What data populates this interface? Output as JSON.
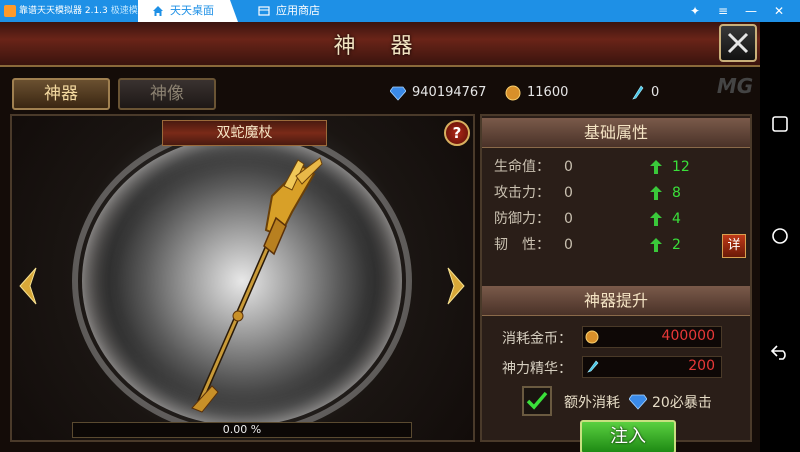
{
  "emulator": {
    "app_title": "靠谱天天模拟器 2.1.3",
    "app_mode": "极速模式",
    "tabs": [
      {
        "label": "天天桌面"
      },
      {
        "label": "应用商店"
      }
    ]
  },
  "game": {
    "title": "神 器",
    "tabs": [
      {
        "label": "神器"
      },
      {
        "label": "神像"
      }
    ],
    "currency": {
      "diamonds": "940194767",
      "gold": "11600",
      "feathers": "0"
    },
    "artifact": {
      "name": "双蛇魔杖",
      "progress_text": "0.00 %",
      "progress_fraction": 0.0
    },
    "base_stats": {
      "title": "基础属性",
      "rows": [
        {
          "label": "生命值：",
          "value": "0",
          "increase": "12"
        },
        {
          "label": "攻击力：",
          "value": "0",
          "increase": "8"
        },
        {
          "label": "防御力：",
          "value": "0",
          "increase": "4"
        },
        {
          "label": "韧　性：",
          "value": "0",
          "increase": "2"
        }
      ],
      "detail_label": "详"
    },
    "upgrade": {
      "title": "神器提升",
      "gold_cost_label": "消耗金币：",
      "gold_cost": "400000",
      "essence_label": "神力精华：",
      "essence_cost": "200",
      "extra_label": "额外消耗",
      "extra_text": "20必暴击",
      "extra_checked": true,
      "inject_label": "注入"
    }
  },
  "colors": {
    "titlebar": "#1e90e6",
    "increase": "#3ae03a",
    "cost": "#e83838"
  }
}
